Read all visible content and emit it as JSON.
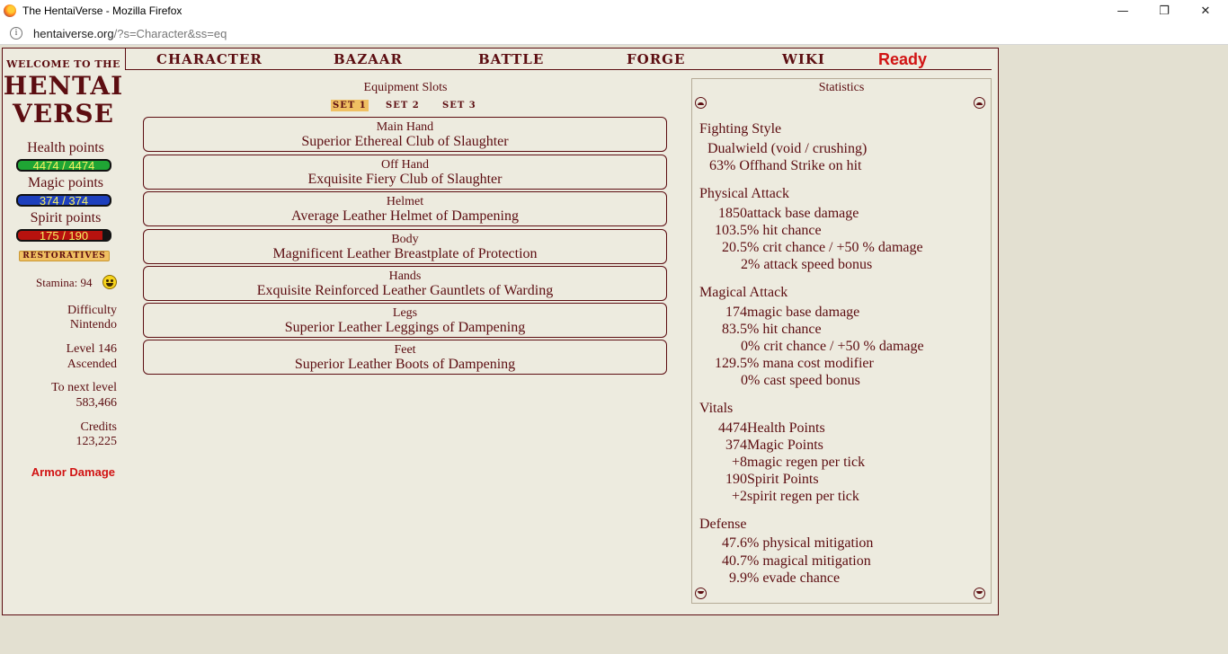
{
  "browser": {
    "window_title": "The HentaiVerse - Mozilla Firefox",
    "url_host": "hentaiverse.org",
    "url_path": "/?s=Character&ss=eq"
  },
  "sidebar": {
    "welcome_line1": "WELCOME TO THE",
    "welcome_line2": "HENTAI",
    "welcome_line3": "VERSE",
    "health_label": "Health points",
    "health_value": "4474 / 4474",
    "health_fraction": 1.0,
    "magic_label": "Magic points",
    "magic_value": "374 / 374",
    "magic_fraction": 1.0,
    "spirit_label": "Spirit points",
    "spirit_value": "175 / 190",
    "spirit_fraction": 0.92,
    "restoratives": "RESTORATIVES",
    "stamina": "Stamina: 94",
    "difficulty_label": "Difficulty",
    "difficulty_value": "Nintendo",
    "level_label": "Level 146",
    "level_value": "Ascended",
    "next_level_label": "To next level",
    "next_level_value": "583,466",
    "credits_label": "Credits",
    "credits_value": "123,225",
    "armor_damage": "Armor Damage"
  },
  "nav": {
    "character": "CHARACTER",
    "bazaar": "BAZAAR",
    "battle": "BATTLE",
    "forge": "FORGE",
    "wiki": "WIKI",
    "status": "Ready"
  },
  "equipment": {
    "title": "Equipment Slots",
    "sets": [
      "SET 1",
      "SET 2",
      "SET 3"
    ],
    "active_set": 0,
    "slots": [
      {
        "label": "Main Hand",
        "item": "Superior Ethereal Club of Slaughter"
      },
      {
        "label": "Off Hand",
        "item": "Exquisite Fiery Club of Slaughter"
      },
      {
        "label": "Helmet",
        "item": "Average Leather Helmet of Dampening"
      },
      {
        "label": "Body",
        "item": "Magnificent Leather Breastplate of Protection"
      },
      {
        "label": "Hands",
        "item": "Exquisite Reinforced Leather Gauntlets of Warding"
      },
      {
        "label": "Legs",
        "item": "Superior Leather Leggings of Dampening"
      },
      {
        "label": "Feet",
        "item": "Superior Leather Boots of Dampening"
      }
    ]
  },
  "statistics": {
    "title": "Statistics",
    "fighting_style": {
      "heading": "Fighting Style",
      "lines": [
        "Dualwield (void / crushing)",
        "63% Offhand Strike on hit"
      ]
    },
    "physical_attack": {
      "heading": "Physical Attack",
      "lines": [
        "1850attack base damage",
        "103.5% hit chance",
        "20.5% crit chance / +50 % damage",
        "2% attack speed bonus"
      ]
    },
    "magical_attack": {
      "heading": "Magical Attack",
      "lines": [
        "174magic base damage",
        "83.5% hit chance",
        "0% crit chance / +50 % damage",
        "129.5% mana cost modifier",
        "0% cast speed bonus"
      ]
    },
    "vitals": {
      "heading": "Vitals",
      "lines": [
        "4474Health Points",
        "374Magic Points",
        "+8magic regen per tick",
        "190Spirit Points",
        "+2spirit regen per tick"
      ]
    },
    "defense": {
      "heading": "Defense",
      "lines": [
        "47.6% physical mitigation",
        "40.7% magical mitigation",
        "9.9% evade chance"
      ]
    }
  },
  "colors": {
    "text": "#5c0d11",
    "frame_bg": "#edebdf",
    "page_bg": "#e3e0d1",
    "accent_red": "#d11313",
    "tab_highlight": "#f0c062",
    "hp_bar": "#1fa534",
    "mp_bar": "#1d3fbd",
    "sp_bar": "#b7120e",
    "bar_text": "#f7f262"
  },
  "icons": {
    "browser": "firefox-icon",
    "site_info": "info-icon",
    "stamina": "smiley-icon",
    "scroll": "scroll-arrow-icon"
  }
}
